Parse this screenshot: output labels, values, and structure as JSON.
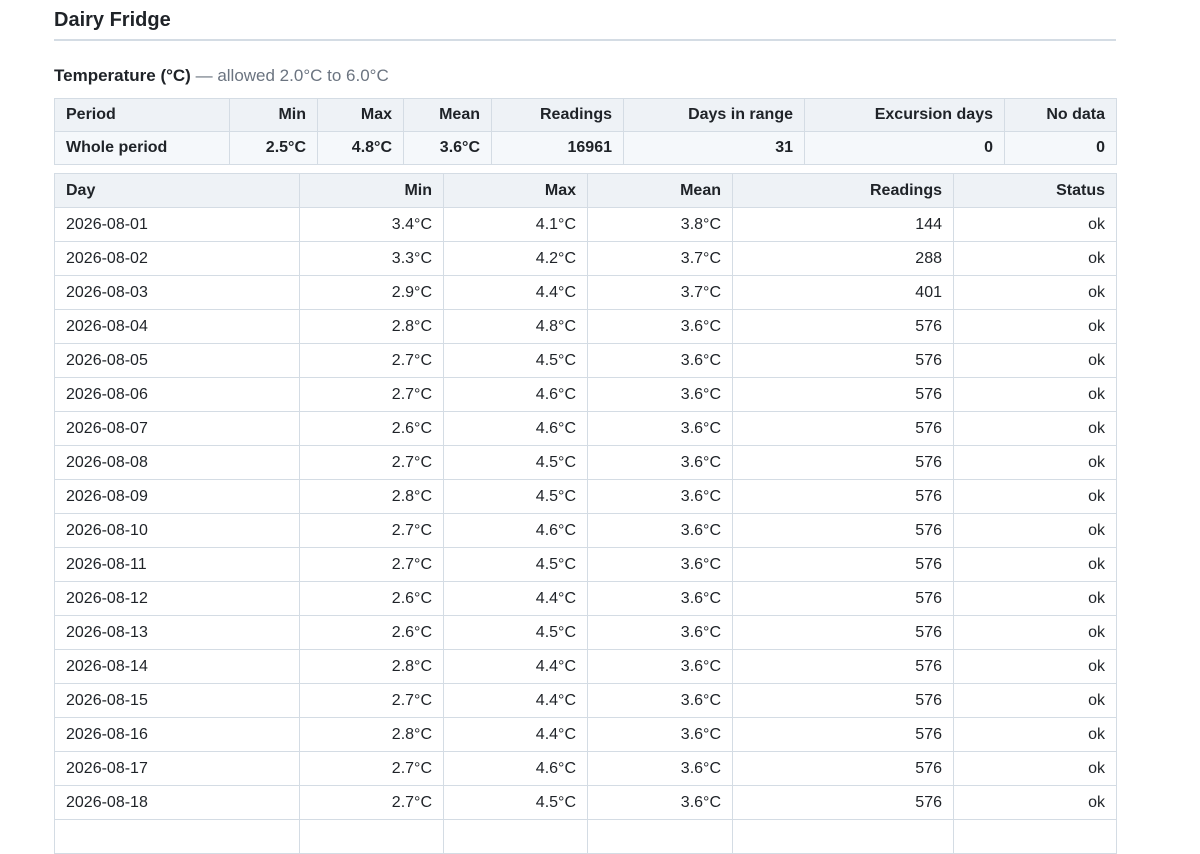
{
  "fridge_name": "Dairy Fridge",
  "section": {
    "label": "Temperature (°C)",
    "separator": "—",
    "allowed": "allowed 2.0°C to 6.0°C"
  },
  "summary": {
    "headers": [
      "Period",
      "Min",
      "Max",
      "Mean",
      "Readings",
      "Days in range",
      "Excursion days",
      "No data"
    ],
    "row": [
      "Whole period",
      "2.5°C",
      "4.8°C",
      "3.6°C",
      "16961",
      "31",
      "0",
      "0"
    ]
  },
  "daily": {
    "headers": [
      "Day",
      "Min",
      "Max",
      "Mean",
      "Readings",
      "Status"
    ],
    "rows": [
      [
        "2026-08-01",
        "3.4°C",
        "4.1°C",
        "3.8°C",
        "144",
        "ok"
      ],
      [
        "2026-08-02",
        "3.3°C",
        "4.2°C",
        "3.7°C",
        "288",
        "ok"
      ],
      [
        "2026-08-03",
        "2.9°C",
        "4.4°C",
        "3.7°C",
        "401",
        "ok"
      ],
      [
        "2026-08-04",
        "2.8°C",
        "4.8°C",
        "3.6°C",
        "576",
        "ok"
      ],
      [
        "2026-08-05",
        "2.7°C",
        "4.5°C",
        "3.6°C",
        "576",
        "ok"
      ],
      [
        "2026-08-06",
        "2.7°C",
        "4.6°C",
        "3.6°C",
        "576",
        "ok"
      ],
      [
        "2026-08-07",
        "2.6°C",
        "4.6°C",
        "3.6°C",
        "576",
        "ok"
      ],
      [
        "2026-08-08",
        "2.7°C",
        "4.5°C",
        "3.6°C",
        "576",
        "ok"
      ],
      [
        "2026-08-09",
        "2.8°C",
        "4.5°C",
        "3.6°C",
        "576",
        "ok"
      ],
      [
        "2026-08-10",
        "2.7°C",
        "4.6°C",
        "3.6°C",
        "576",
        "ok"
      ],
      [
        "2026-08-11",
        "2.7°C",
        "4.5°C",
        "3.6°C",
        "576",
        "ok"
      ],
      [
        "2026-08-12",
        "2.6°C",
        "4.4°C",
        "3.6°C",
        "576",
        "ok"
      ],
      [
        "2026-08-13",
        "2.6°C",
        "4.5°C",
        "3.6°C",
        "576",
        "ok"
      ],
      [
        "2026-08-14",
        "2.8°C",
        "4.4°C",
        "3.6°C",
        "576",
        "ok"
      ],
      [
        "2026-08-15",
        "2.7°C",
        "4.4°C",
        "3.6°C",
        "576",
        "ok"
      ],
      [
        "2026-08-16",
        "2.8°C",
        "4.4°C",
        "3.6°C",
        "576",
        "ok"
      ],
      [
        "2026-08-17",
        "2.7°C",
        "4.6°C",
        "3.6°C",
        "576",
        "ok"
      ],
      [
        "2026-08-18",
        "2.7°C",
        "4.5°C",
        "3.6°C",
        "576",
        "ok"
      ],
      [
        "",
        "",
        "",
        "",
        "",
        ""
      ]
    ]
  }
}
